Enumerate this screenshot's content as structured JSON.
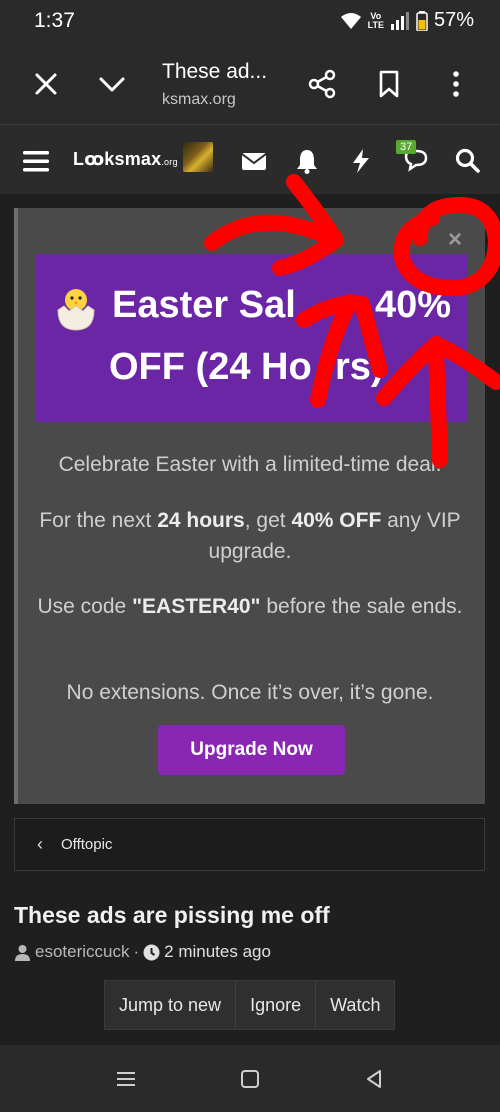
{
  "status_bar": {
    "time": "1:37",
    "battery": "57%",
    "lte_top": "Vo",
    "lte_bottom": "LTE"
  },
  "browser": {
    "title": "These ad...",
    "url": "​ksmax.org"
  },
  "site": {
    "logo_main": "Lꝏksmax",
    "logo_suffix": ".org",
    "alerts_badge": "37"
  },
  "notice": {
    "banner_line1": "Easter Sal",
    "banner_line1_right": "40%",
    "banner_line2": "OFF (24 Ho",
    "banner_line2_right": "rs)",
    "p1": "Celebrate Easter with a limited-time deal.",
    "p2_a": "For the next ",
    "p2_b": "24 hours",
    "p2_c": ", get ",
    "p2_d": "40% OFF",
    "p2_e": " any VIP upgrade.",
    "p3_a": "Use code ",
    "p3_b": "\"EASTER40\"",
    "p3_c": " before the sale ends.",
    "p4": "No extensions. Once it’s over, it’s gone.",
    "button": "Upgrade Now",
    "close": "×"
  },
  "breadcrumb": {
    "label": "Offtopic"
  },
  "thread": {
    "title": "These ads are pissing me off",
    "author": "esotericcuck",
    "separator": "·",
    "time": "2 minutes ago"
  },
  "actions": [
    "Jump to new",
    "Ignore",
    "Watch"
  ],
  "colors": {
    "banner": "#6b26a6",
    "button": "#8a27b2",
    "scribble": "#ff0000"
  }
}
